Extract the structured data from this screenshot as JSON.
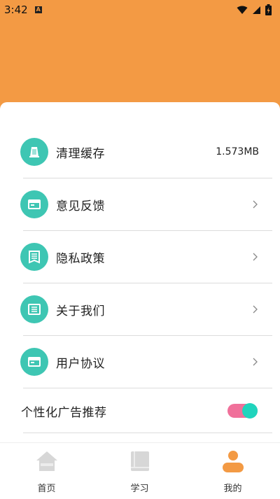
{
  "status_bar": {
    "time": "3:42",
    "notif_badge": "A"
  },
  "settings": {
    "items": [
      {
        "label": "清理缓存",
        "value": "1.573MB",
        "icon": "cache-icon"
      },
      {
        "label": "意见反馈",
        "icon": "feedback-icon"
      },
      {
        "label": "隐私政策",
        "icon": "document-icon"
      },
      {
        "label": "关于我们",
        "icon": "info-list-icon"
      },
      {
        "label": "用户协议",
        "icon": "agreement-icon"
      }
    ],
    "personalized_ads": {
      "label": "个性化广告推荐",
      "enabled": true
    }
  },
  "nav": {
    "items": [
      {
        "label": "首页",
        "icon": "home-icon",
        "active": false
      },
      {
        "label": "学习",
        "icon": "book-icon",
        "active": false
      },
      {
        "label": "我的",
        "icon": "profile-icon",
        "active": true
      }
    ]
  },
  "colors": {
    "header": "#f39a44",
    "accent": "#3ec6b3",
    "toggle_track": "#f0709a",
    "toggle_knob": "#20d4bd",
    "inactive_icon": "#d7d7d7",
    "active_icon": "#f39a44"
  }
}
